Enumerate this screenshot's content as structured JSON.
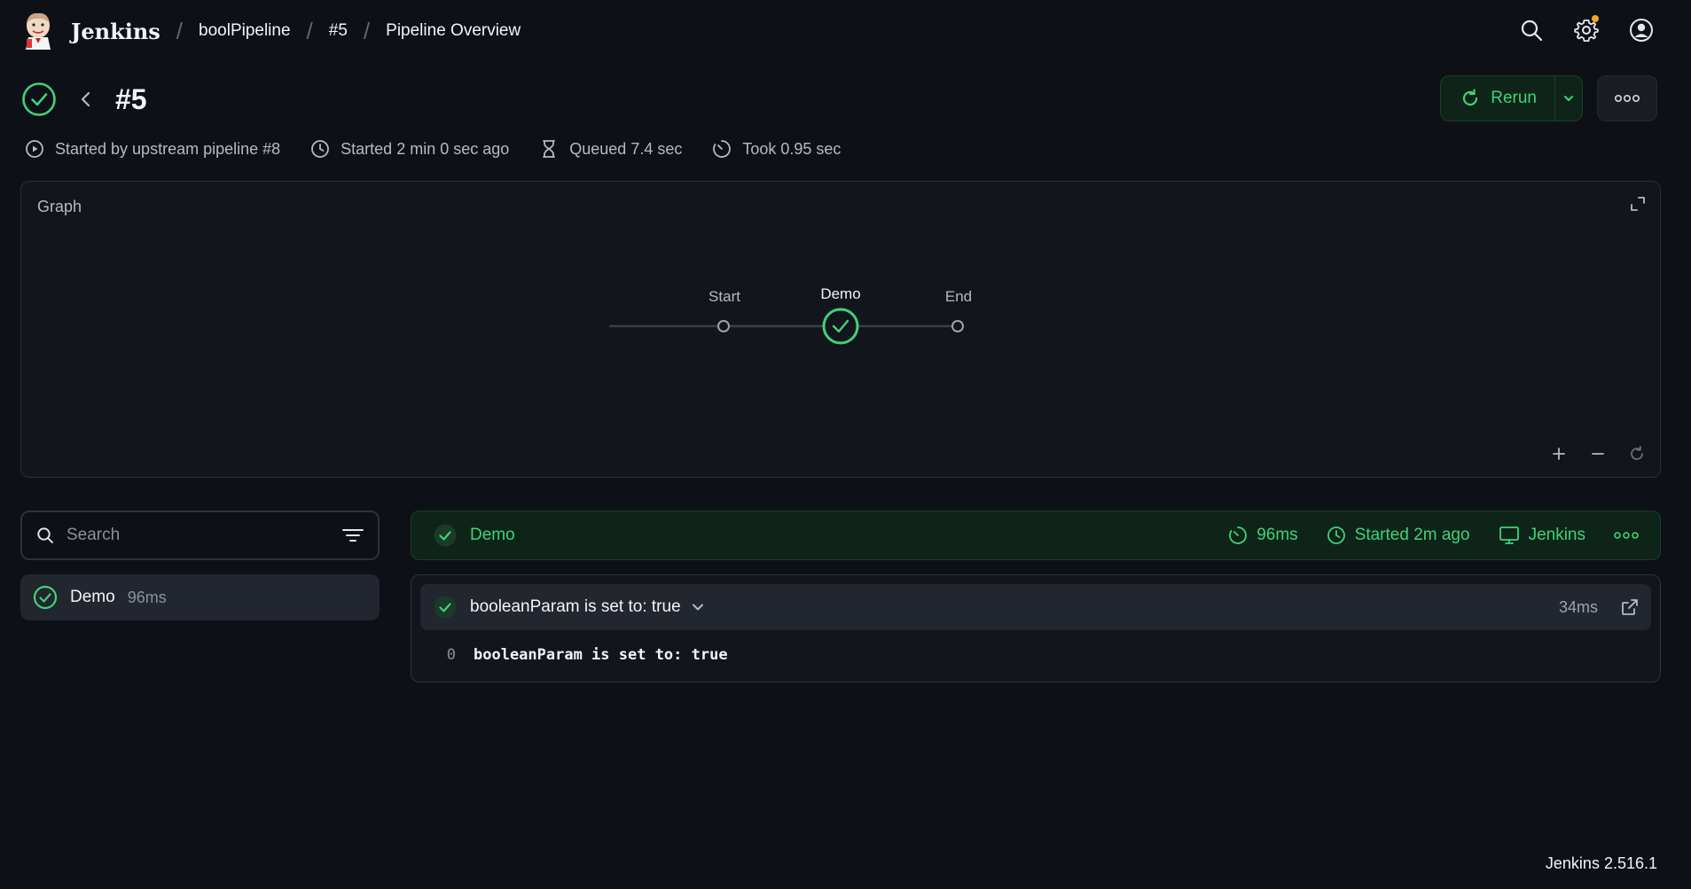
{
  "header": {
    "brand": "Jenkins",
    "breadcrumbs": [
      "boolPipeline",
      "#5",
      "Pipeline Overview"
    ],
    "icons": [
      "search-icon",
      "gear-icon",
      "user-icon"
    ],
    "notification_color": "#f5a623"
  },
  "run": {
    "title": "#5",
    "status": "success",
    "rerun_label": "Rerun",
    "meta": {
      "started_by": "Started by upstream pipeline #8",
      "started": "Started 2 min 0 sec ago",
      "queued": "Queued 7.4 sec",
      "took": "Took 0.95 sec"
    }
  },
  "graph": {
    "title": "Graph",
    "nodes": [
      {
        "label": "Start",
        "status": "none"
      },
      {
        "label": "Demo",
        "status": "success"
      },
      {
        "label": "End",
        "status": "none"
      }
    ]
  },
  "sidebar": {
    "search_placeholder": "Search",
    "stages": [
      {
        "name": "Demo",
        "duration": "96ms",
        "status": "success"
      }
    ]
  },
  "stage_detail": {
    "name": "Demo",
    "duration": "96ms",
    "started": "Started 2m ago",
    "agent": "Jenkins",
    "steps": [
      {
        "title": "booleanParam is set to: true",
        "duration": "34ms",
        "log": [
          {
            "line": "0",
            "text": "booleanParam is set to: true"
          }
        ]
      }
    ]
  },
  "footer": {
    "version": "Jenkins 2.516.1"
  },
  "colors": {
    "success": "#3fd27a",
    "background": "#0d1017",
    "panel": "#12151c"
  }
}
